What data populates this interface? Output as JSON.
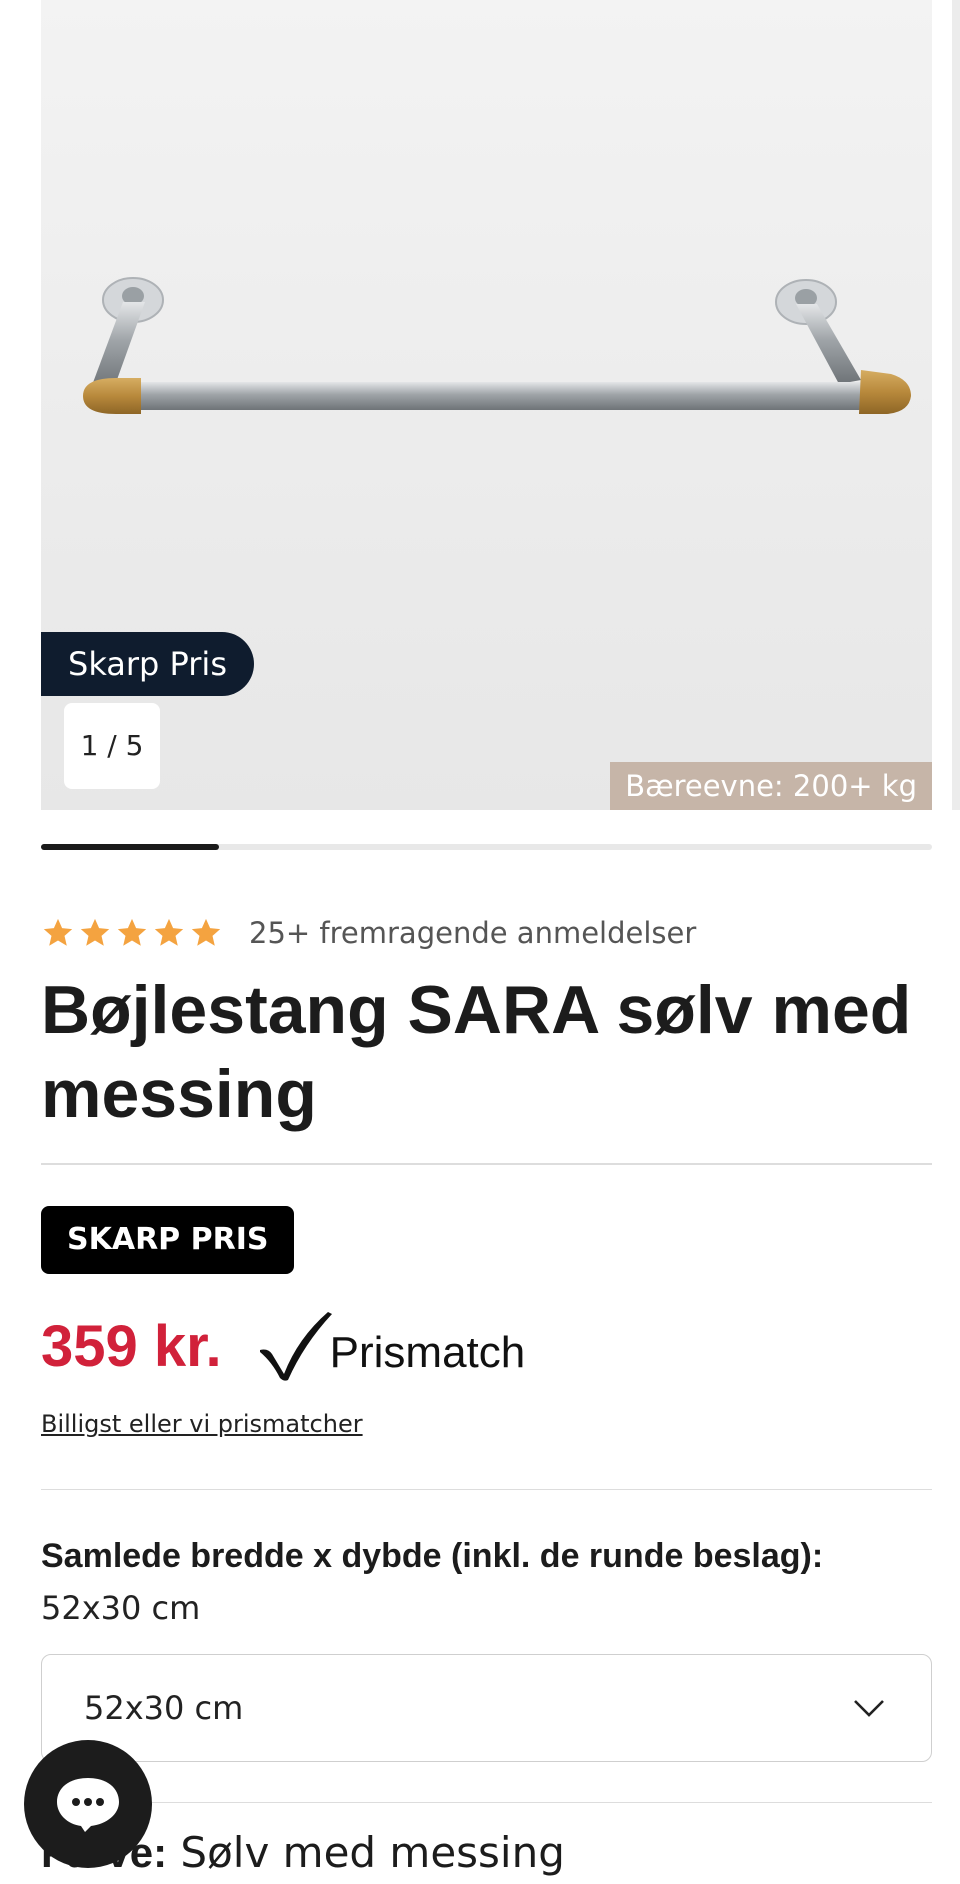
{
  "gallery": {
    "badge": "Skarp Pris",
    "counter": "1 / 5",
    "spec_badge": "Bæreevne: 200+ kg",
    "image_icon": "clothes-rail-image",
    "progress": 0.2
  },
  "rating": {
    "stars": 5,
    "star_color": "#f4a340",
    "text": "25+ fremragende anmeldelser"
  },
  "product": {
    "title": "Bøjlestang SARA sølv med messing",
    "sale_badge": "SKARP PRIS",
    "price": "359 kr.",
    "price_color": "#d1213a",
    "prismatch": "Prismatch",
    "price_link": "Billigst eller vi prismatcher"
  },
  "size": {
    "label": "Samlede bredde x dybde (inkl. de runde beslag):",
    "value": "52x30 cm",
    "selected": "52x30 cm"
  },
  "color": {
    "label": "Farve:",
    "value": "Sølv med messing"
  },
  "chat": {
    "icon": "chat-dots-icon"
  }
}
